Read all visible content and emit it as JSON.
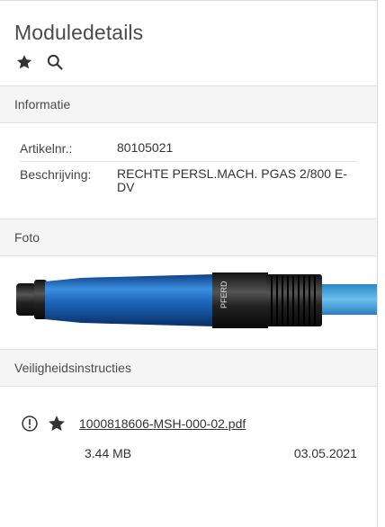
{
  "header": {
    "title": "Moduledetails",
    "icons": [
      "star-icon",
      "search-icon"
    ]
  },
  "informatie": {
    "heading": "Informatie",
    "rows": [
      {
        "label": "Artikelnr.:",
        "value": "80105021"
      },
      {
        "label": "Beschrijving:",
        "value": "RECHTE PERSL.MACH. PGAS 2/800 E-DV"
      }
    ]
  },
  "foto": {
    "heading": "Foto",
    "product_text": "PFERD",
    "colors": {
      "body": "#1f6fc2",
      "hose": "#4aa7dc"
    }
  },
  "veiligheid": {
    "heading": "Veiligheidsinstructies",
    "document": {
      "filename": "1000818606-MSH-000-02.pdf",
      "size": "3.44 MB",
      "date": "03.05.2021",
      "icons": [
        "info-circle-icon",
        "star-icon"
      ]
    }
  }
}
